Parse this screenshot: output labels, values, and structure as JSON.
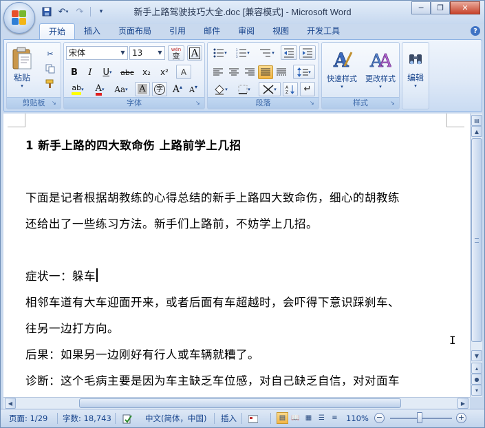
{
  "window": {
    "title": "新手上路驾驶技巧大全.doc [兼容模式] - Microsoft Word",
    "controls": {
      "minimize": "─",
      "restore": "❐",
      "close": "✕"
    }
  },
  "quick_access": [
    {
      "name": "save-icon",
      "glyph": "💾"
    },
    {
      "name": "undo-icon",
      "glyph": "↶"
    },
    {
      "name": "redo-icon",
      "glyph": "↷"
    },
    {
      "name": "customize-qat-icon",
      "glyph": "▾"
    }
  ],
  "ribbon_tabs": [
    "开始",
    "插入",
    "页面布局",
    "引用",
    "邮件",
    "审阅",
    "视图",
    "开发工具"
  ],
  "active_tab": "开始",
  "clipboard": {
    "paste_label": "粘贴",
    "group_label": "剪贴板"
  },
  "font": {
    "font_name": "宋体",
    "font_size": "13",
    "wen_label": "wén",
    "wen_char": "变",
    "char_border": "A",
    "bold": "B",
    "italic": "I",
    "underline": "U",
    "strike": "abc",
    "sub": "x₂",
    "sup": "x²",
    "clear": "A",
    "highlight": "ab",
    "color": "A",
    "case": "Aa",
    "shade": "A",
    "enclose": "字",
    "grow": "A",
    "shrink": "A",
    "group_label": "字体"
  },
  "paragraph": {
    "group_label": "段落"
  },
  "styles": {
    "quick_styles_label": "快速样式",
    "change_styles_label": "更改样式",
    "group_label": "样式"
  },
  "editing": {
    "label": "编辑"
  },
  "document": {
    "heading": "1  新手上路的四大致命伤 上路前学上几招",
    "lines": [
      "",
      "1  新手上路的四大致命伤 上路前学上几招",
      "",
      "下面是记者根据胡教练的心得总结的新手上路四大致命伤，细心的胡教练",
      "还给出了一些练习方法。新手们上路前，不妨学上几招。",
      "",
      "症状一：躲车",
      "相邻车道有大车迎面开来，或者后面有车超越时，会吓得下意识踩刹车、",
      "往另一边打方向。",
      "后果：如果另一边刚好有行人或车辆就糟了。",
      "诊断：这个毛病主要是因为车主缺乏车位感，对自己缺乏自信，对对面车"
    ]
  },
  "status_bar": {
    "page": "页面: 1/29",
    "words": "字数: 18,743",
    "language": "中文(简体，中国)",
    "mode": "插入",
    "zoom": "110%"
  },
  "colors": {
    "ribbon_text": "#15428b",
    "highlight_yellow": "#ffff00",
    "font_color_red": "#e02020",
    "active_button": "#f4b645"
  }
}
